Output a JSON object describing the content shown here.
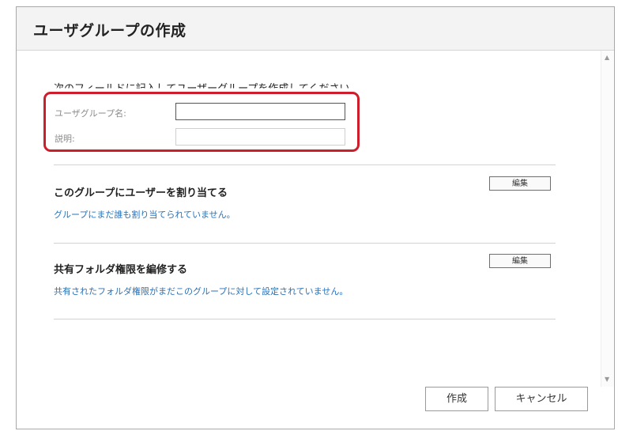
{
  "dialog": {
    "title": "ユーザグループの作成"
  },
  "form": {
    "instruction": "次のフィールドに記入してユーザーグループを作成してください。",
    "group_name_label": "ユーザグループ名:",
    "group_name_value": "",
    "description_label": "説明:",
    "description_value": ""
  },
  "sections": {
    "assign_users": {
      "title": "このグループにユーザーを割り当てる",
      "note": "グループにまだ誰も割り当てられていません。",
      "edit_label": "編集"
    },
    "shared_folder": {
      "title": "共有フォルダ権限を編修する",
      "note": "共有されたフォルダ権限がまだこのグループに対して設定されていません。",
      "edit_label": "編集"
    }
  },
  "footer": {
    "create_label": "作成",
    "cancel_label": "キャンセル"
  },
  "colors": {
    "highlight_border": "#cc1f2b",
    "link_text": "#2a72b8"
  },
  "icons": {
    "scroll_up": "scroll-up-arrow-icon",
    "scroll_down": "scroll-down-arrow-icon"
  }
}
